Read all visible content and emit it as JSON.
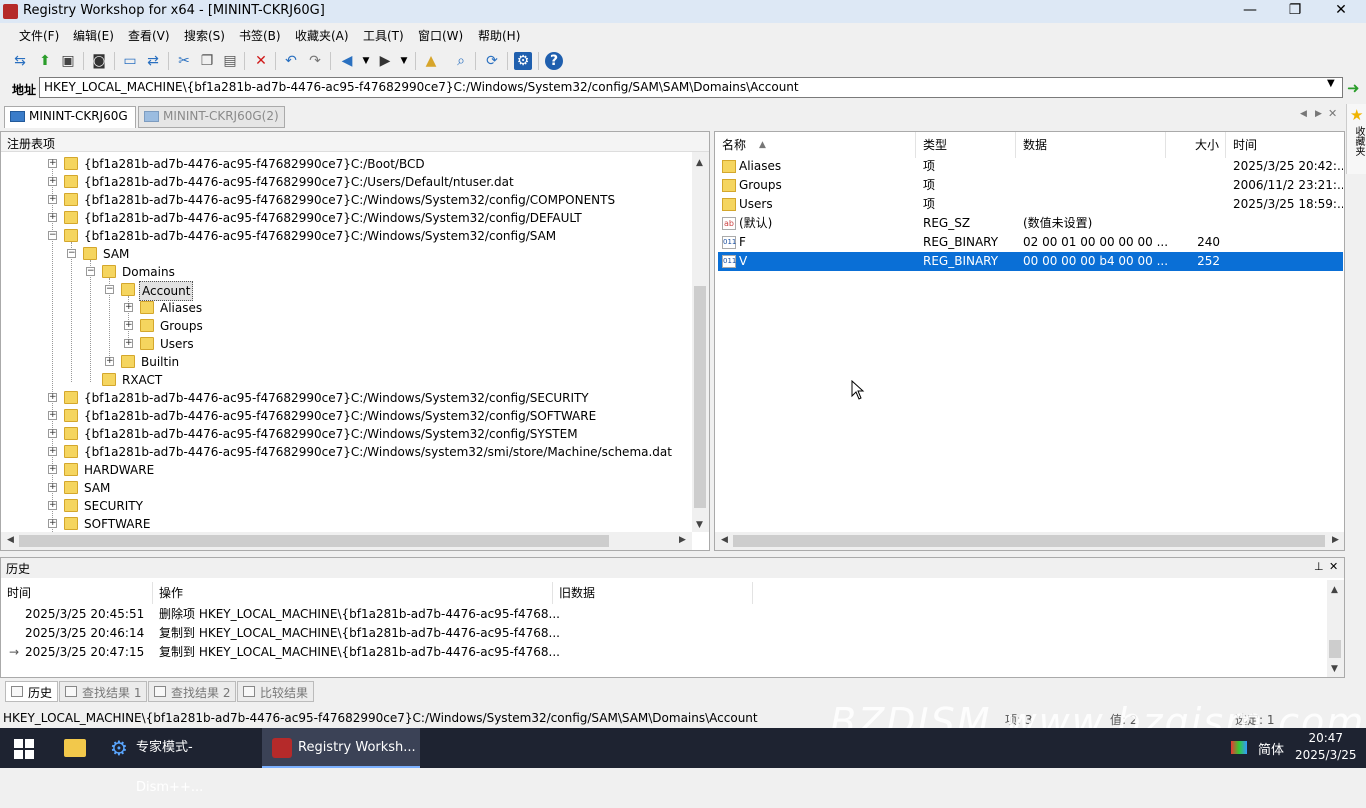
{
  "window": {
    "title": "Registry Workshop for x64 - [MININT-CKRJ60G]",
    "min_icon": "—",
    "restore_icon": "❐",
    "close_icon": "✕"
  },
  "menu": [
    "文件(F)",
    "编辑(E)",
    "查看(V)",
    "搜索(S)",
    "书签(B)",
    "收藏夹(A)",
    "工具(T)",
    "窗口(W)",
    "帮助(H)"
  ],
  "toolbar_icons": [
    "connect-icon",
    "import-icon",
    "save-icon",
    "snapshot-icon",
    "computer-icon",
    "remote-icon",
    "cut-icon",
    "copy-icon",
    "paste-icon",
    "delete-icon",
    "undo-icon",
    "redo-icon",
    "back-icon",
    "forward-icon",
    "up-folder-icon",
    "find-icon",
    "refresh-icon",
    "settings-icon",
    "help-icon"
  ],
  "address": {
    "label": "地址",
    "value": "HKEY_LOCAL_MACHINE\\{bf1a281b-ad7b-4476-ac95-f47682990ce7}C:/Windows/System32/config/SAM\\SAM\\Domains\\Account"
  },
  "tabs": [
    "MININT-CKRJ60G",
    "MININT-CKRJ60G(2)"
  ],
  "favorites_label": "收藏夹",
  "tree": {
    "header": "注册表项",
    "items": [
      "{bf1a281b-ad7b-4476-ac95-f47682990ce7}C:/Boot/BCD",
      "{bf1a281b-ad7b-4476-ac95-f47682990ce7}C:/Users/Default/ntuser.dat",
      "{bf1a281b-ad7b-4476-ac95-f47682990ce7}C:/Windows/System32/config/COMPONENTS",
      "{bf1a281b-ad7b-4476-ac95-f47682990ce7}C:/Windows/System32/config/DEFAULT",
      "{bf1a281b-ad7b-4476-ac95-f47682990ce7}C:/Windows/System32/config/SAM",
      "SAM",
      "Domains",
      "Account",
      "Aliases",
      "Groups",
      "Users",
      "Builtin",
      "RXACT",
      "{bf1a281b-ad7b-4476-ac95-f47682990ce7}C:/Windows/System32/config/SECURITY",
      "{bf1a281b-ad7b-4476-ac95-f47682990ce7}C:/Windows/System32/config/SOFTWARE",
      "{bf1a281b-ad7b-4476-ac95-f47682990ce7}C:/Windows/System32/config/SYSTEM",
      "{bf1a281b-ad7b-4476-ac95-f47682990ce7}C:/Windows/system32/smi/store/Machine/schema.dat",
      "HARDWARE",
      "SAM",
      "SECURITY",
      "SOFTWARE"
    ]
  },
  "list": {
    "columns": [
      "名称",
      "类型",
      "数据",
      "大小",
      "时间"
    ],
    "rows": [
      {
        "name": "Aliases",
        "type": "项",
        "data": "",
        "size": "",
        "time": "2025/3/25 20:42:...",
        "icon": "folder-icon"
      },
      {
        "name": "Groups",
        "type": "项",
        "data": "",
        "size": "",
        "time": "2006/11/2 23:21:...",
        "icon": "folder-icon"
      },
      {
        "name": "Users",
        "type": "项",
        "data": "",
        "size": "",
        "time": "2025/3/25 18:59:...",
        "icon": "folder-icon"
      },
      {
        "name": "(默认)",
        "type": "REG_SZ",
        "data": "(数值未设置)",
        "size": "",
        "time": "",
        "icon": "string-value-icon"
      },
      {
        "name": "F",
        "type": "REG_BINARY",
        "data": "02 00 01 00 00 00 00 ...",
        "size": "240",
        "time": "",
        "icon": "binary-value-icon"
      },
      {
        "name": "V",
        "type": "REG_BINARY",
        "data": "00 00 00 00 b4 00 00 ...",
        "size": "252",
        "time": "",
        "icon": "binary-value-icon"
      }
    ],
    "selected": 5
  },
  "history": {
    "title": "历史",
    "columns": [
      "时间",
      "操作",
      "旧数据"
    ],
    "rows": [
      {
        "time": "2025/3/25 20:45:51",
        "op": "删除项 HKEY_LOCAL_MACHINE\\{bf1a281b-ad7b-4476-ac95-f4768...",
        "old": ""
      },
      {
        "time": "2025/3/25 20:46:14",
        "op": "复制到 HKEY_LOCAL_MACHINE\\{bf1a281b-ad7b-4476-ac95-f4768...",
        "old": ""
      },
      {
        "time": "2025/3/25 20:47:15",
        "op": "复制到 HKEY_LOCAL_MACHINE\\{bf1a281b-ad7b-4476-ac95-f4768...",
        "old": ""
      }
    ],
    "current_marker": "→"
  },
  "bottom_tabs": [
    "历史",
    "查找结果 1",
    "查找结果 2",
    "比较结果"
  ],
  "status": {
    "path": "HKEY_LOCAL_MACHINE\\{bf1a281b-ad7b-4476-ac95-f47682990ce7}C:/Windows/System32/config/SAM\\SAM\\Domains\\Account",
    "watermark": "BZDJSM www.bzgjsm.com",
    "field1": "项: 3",
    "field2": "值: 2",
    "field3": "选定: 1"
  },
  "taskbar": {
    "tasks": [
      "专家模式-Dism++...",
      "Registry Worksh..."
    ],
    "ime": "简体",
    "time": "20:47",
    "date": "2025/3/25"
  },
  "colors": {
    "selection": "#0a6fd6",
    "taskbar": "#1e2331",
    "folder": "#f5d55f"
  }
}
